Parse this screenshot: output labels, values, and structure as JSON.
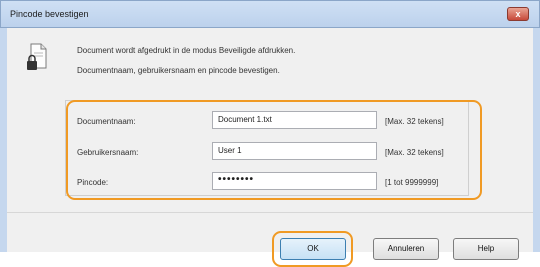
{
  "window": {
    "title": "Pincode bevestigen",
    "close_label": "x"
  },
  "message": {
    "line1": "Document wordt afgedrukt in de modus Beveiligde afdrukken.",
    "line2": "Documentnaam, gebruikersnaam en pincode bevestigen."
  },
  "fields": [
    {
      "label": "Documentnaam:",
      "value": "Document 1.txt",
      "hint": "[Max. 32 tekens]"
    },
    {
      "label": "Gebruikersnaam:",
      "value": "User 1",
      "hint": "[Max. 32 tekens]"
    },
    {
      "label": "Pincode:",
      "value": "••••••••",
      "hint": "[1 tot 9999999]"
    }
  ],
  "buttons": {
    "ok": "OK",
    "cancel": "Annuleren",
    "help": "Help"
  },
  "colors": {
    "highlight": "#f09a24",
    "titlebar": "#bcd1ec"
  },
  "icons": {
    "dialog_icon": "document-lock-icon"
  }
}
